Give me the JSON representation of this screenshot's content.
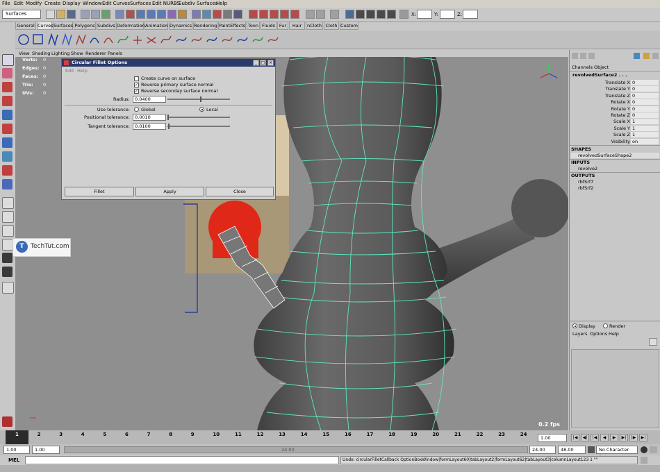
{
  "menubar": [
    "File",
    "Edit",
    "Modify",
    "Create",
    "Display",
    "Window",
    "Edit Curves",
    "Surfaces",
    "Edit NURBS",
    "Subdiv Surfaces",
    "Help"
  ],
  "status_line": {
    "mode": "Surfaces",
    "coord_x_label": "X:",
    "coord_y_label": "Y:",
    "coord_z_label": "Z:"
  },
  "shelf_tabs": [
    "General",
    "Curves",
    "Surfaces",
    "Polygons",
    "Subdivs",
    "Deformation",
    "Animation",
    "Dynamics",
    "Rendering",
    "PaintEffects",
    "Toon",
    "Fluids",
    "Fur",
    "Hair",
    "nCloth",
    "Cloth",
    "Custom"
  ],
  "shelf_active": "Curves",
  "viewport": {
    "menu": [
      "View",
      "Shading",
      "Lighting",
      "Show",
      "Renderer",
      "Panels"
    ],
    "hud": [
      {
        "label": "Verts:",
        "value": "0"
      },
      {
        "label": "Edges:",
        "value": "0"
      },
      {
        "label": "Faces:",
        "value": "0"
      },
      {
        "label": "Tris:",
        "value": "0"
      },
      {
        "label": "UVs:",
        "value": "0"
      }
    ],
    "fps": "0.2 fps",
    "watermark": "TechTut.com"
  },
  "dialog": {
    "title": "Circular Fillet Options",
    "menu": [
      "Edit",
      "Help"
    ],
    "options": [
      {
        "label": "Create curve on surface",
        "checked": false
      },
      {
        "label": "Reverse primary surface normal",
        "checked": true
      },
      {
        "label": "Reverse seconday surface normal",
        "checked": true
      }
    ],
    "radius_label": "Radius:",
    "radius_value": "0.0400",
    "use_tolerance_label": "Use tolerance:",
    "tol_global": "Global",
    "tol_local": "Local",
    "tol_selected": "Local",
    "positional_label": "Positional tolerance:",
    "positional_value": "0.0010",
    "tangent_label": "Tangent tolerance:",
    "tangent_value": "0.0100",
    "buttons": [
      "Fillet",
      "Apply",
      "Close"
    ]
  },
  "channel_box": {
    "tabs": [
      "Channels",
      "Object"
    ],
    "object_name": "revolvedSurface2 . . .",
    "attributes": [
      {
        "name": "Translate X",
        "value": "0"
      },
      {
        "name": "Translate Y",
        "value": "0"
      },
      {
        "name": "Translate Z",
        "value": "0"
      },
      {
        "name": "Rotate X",
        "value": "0"
      },
      {
        "name": "Rotate Y",
        "value": "0"
      },
      {
        "name": "Rotate Z",
        "value": "0"
      },
      {
        "name": "Scale X",
        "value": "1"
      },
      {
        "name": "Scale Y",
        "value": "1"
      },
      {
        "name": "Scale Z",
        "value": "1"
      },
      {
        "name": "Visibility",
        "value": "on"
      }
    ],
    "shapes_header": "SHAPES",
    "shapes": [
      "revolvedSurfaceShape2"
    ],
    "inputs_header": "INPUTS",
    "inputs": [
      "revolve2"
    ],
    "outputs_header": "OUTPUTS",
    "outputs": [
      "rbfSrf7",
      "rbfSrf2"
    ]
  },
  "layer_panel": {
    "display": "Display",
    "render": "Render",
    "menu": [
      "Layers",
      "Options",
      "Help"
    ]
  },
  "timeline": {
    "ticks": [
      "1",
      "2",
      "3",
      "4",
      "5",
      "6",
      "7",
      "8",
      "9",
      "10",
      "11",
      "12",
      "13",
      "14",
      "15",
      "16",
      "17",
      "18",
      "19",
      "20",
      "21",
      "22",
      "23",
      "24"
    ],
    "current_frame": "1.00",
    "range_start": "1.00",
    "range_inner_start": "1.00",
    "range_label": "24.00",
    "range_end": "24.00",
    "playback_end": "48.00",
    "character_set": "No Character Set"
  },
  "command": {
    "label": "MEL",
    "result": "Undo: circularFilletCallback OptionBoxWindow|formLayout60|tabLayout2|formLayout62|tabLayout3|columnLayout123 1 \"\""
  },
  "colors": {
    "wire": "#5fe8c2",
    "title_bar": "#2a3a6a",
    "viewport_bg": "#8f8f8f"
  }
}
